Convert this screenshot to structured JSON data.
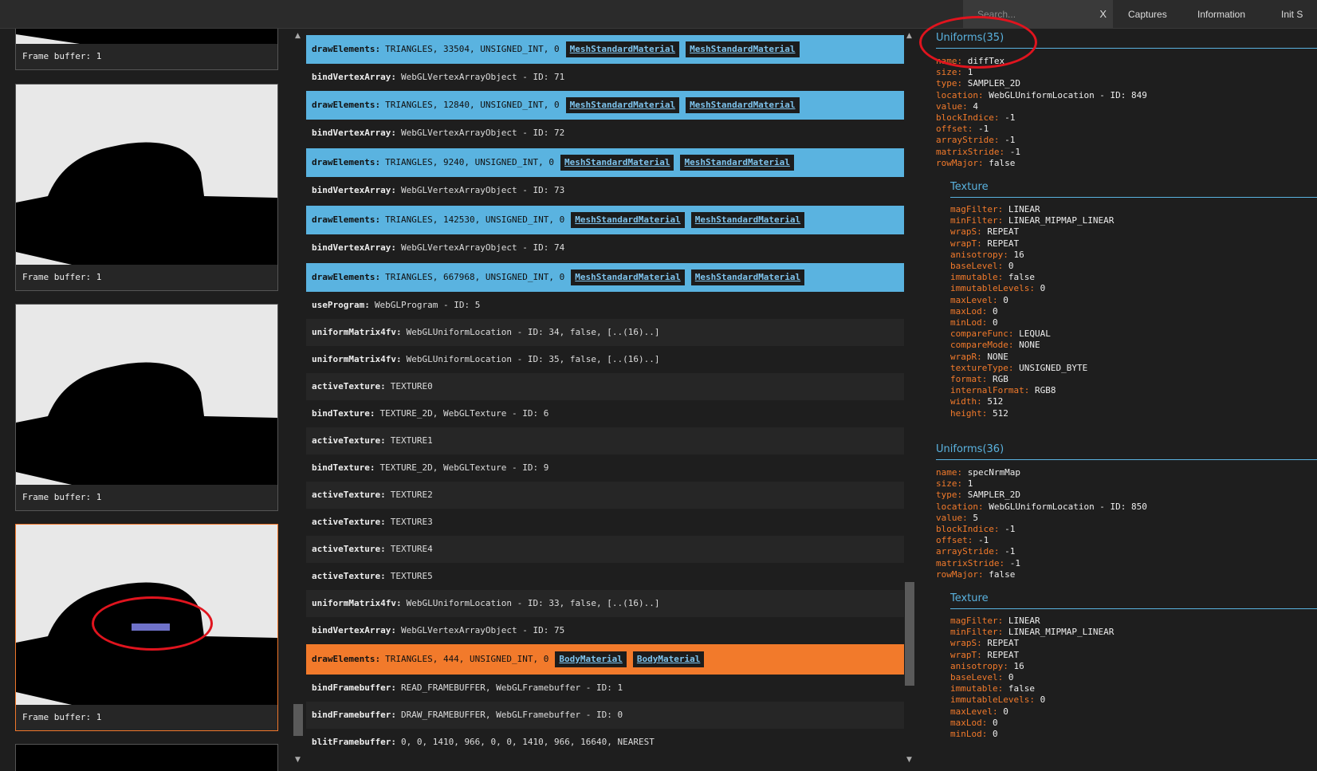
{
  "topbar": {
    "search_placeholder": "Search...",
    "search_close": "X",
    "tabs": [
      "Captures",
      "Information",
      "Init S"
    ]
  },
  "thumbnails": [
    {
      "caption": "Frame buffer: 1"
    },
    {
      "caption": "Frame buffer: 1"
    },
    {
      "caption": "Frame buffer: 1"
    },
    {
      "caption": "Frame buffer: 1",
      "selected": true
    }
  ],
  "commands": [
    {
      "fn": "drawElements:",
      "args": "TRIANGLES, 33504, UNSIGNED_INT, 0",
      "materials": [
        "MeshStandardMaterial",
        "MeshStandardMaterial"
      ],
      "style": "draw"
    },
    {
      "fn": "bindVertexArray:",
      "args": "WebGLVertexArrayObject - ID: 71",
      "style": "plain"
    },
    {
      "fn": "drawElements:",
      "args": "TRIANGLES, 12840, UNSIGNED_INT, 0",
      "materials": [
        "MeshStandardMaterial",
        "MeshStandardMaterial"
      ],
      "style": "draw"
    },
    {
      "fn": "bindVertexArray:",
      "args": "WebGLVertexArrayObject - ID: 72",
      "style": "plain"
    },
    {
      "fn": "drawElements:",
      "args": "TRIANGLES, 9240, UNSIGNED_INT, 0",
      "materials": [
        "MeshStandardMaterial",
        "MeshStandardMaterial"
      ],
      "style": "draw"
    },
    {
      "fn": "bindVertexArray:",
      "args": "WebGLVertexArrayObject - ID: 73",
      "style": "plain"
    },
    {
      "fn": "drawElements:",
      "args": "TRIANGLES, 142530, UNSIGNED_INT, 0",
      "materials": [
        "MeshStandardMaterial",
        "MeshStandardMaterial"
      ],
      "style": "draw"
    },
    {
      "fn": "bindVertexArray:",
      "args": "WebGLVertexArrayObject - ID: 74",
      "style": "plain"
    },
    {
      "fn": "drawElements:",
      "args": "TRIANGLES, 667968, UNSIGNED_INT, 0",
      "materials": [
        "MeshStandardMaterial",
        "MeshStandardMaterial"
      ],
      "style": "draw"
    },
    {
      "fn": "useProgram:",
      "args": "WebGLProgram - ID: 5",
      "style": "plain"
    },
    {
      "fn": "uniformMatrix4fv:",
      "args": "WebGLUniformLocation - ID: 34, false, [..(16)..]",
      "style": "alt"
    },
    {
      "fn": "uniformMatrix4fv:",
      "args": "WebGLUniformLocation - ID: 35, false, [..(16)..]",
      "style": "plain"
    },
    {
      "fn": "activeTexture:",
      "args": "TEXTURE0",
      "style": "alt"
    },
    {
      "fn": "bindTexture:",
      "args": "TEXTURE_2D, WebGLTexture - ID: 6",
      "style": "plain"
    },
    {
      "fn": "activeTexture:",
      "args": "TEXTURE1",
      "style": "alt"
    },
    {
      "fn": "bindTexture:",
      "args": "TEXTURE_2D, WebGLTexture - ID: 9",
      "style": "plain"
    },
    {
      "fn": "activeTexture:",
      "args": "TEXTURE2",
      "style": "alt"
    },
    {
      "fn": "activeTexture:",
      "args": "TEXTURE3",
      "style": "plain"
    },
    {
      "fn": "activeTexture:",
      "args": "TEXTURE4",
      "style": "alt"
    },
    {
      "fn": "activeTexture:",
      "args": "TEXTURE5",
      "style": "plain"
    },
    {
      "fn": "uniformMatrix4fv:",
      "args": "WebGLUniformLocation - ID: 33, false, [..(16)..]",
      "style": "alt"
    },
    {
      "fn": "bindVertexArray:",
      "args": "WebGLVertexArrayObject - ID: 75",
      "style": "plain"
    },
    {
      "fn": "drawElements:",
      "args": "TRIANGLES, 444, UNSIGNED_INT, 0",
      "materials": [
        "BodyMaterial",
        "BodyMaterial"
      ],
      "style": "draw-orange"
    },
    {
      "fn": "bindFramebuffer:",
      "args": "READ_FRAMEBUFFER, WebGLFramebuffer - ID: 1",
      "style": "plain"
    },
    {
      "fn": "bindFramebuffer:",
      "args": "DRAW_FRAMEBUFFER, WebGLFramebuffer - ID: 0",
      "style": "alt"
    },
    {
      "fn": "blitFramebuffer:",
      "args": "0, 0, 1410, 966, 0, 0, 1410, 966, 16640, NEAREST",
      "style": "plain"
    }
  ],
  "uniforms": [
    {
      "title": "Uniforms(35)",
      "fields": [
        [
          "name:",
          "diffTex"
        ],
        [
          "size:",
          "1"
        ],
        [
          "type:",
          "SAMPLER_2D"
        ],
        [
          "location:",
          "WebGLUniformLocation - ID: 849"
        ],
        [
          "value:",
          "4"
        ],
        [
          "blockIndice:",
          "-1"
        ],
        [
          "offset:",
          "-1"
        ],
        [
          "arrayStride:",
          "-1"
        ],
        [
          "matrixStride:",
          "-1"
        ],
        [
          "rowMajor:",
          "false"
        ]
      ],
      "texture_title": "Texture",
      "texture": [
        [
          "magFilter:",
          "LINEAR"
        ],
        [
          "minFilter:",
          "LINEAR_MIPMAP_LINEAR"
        ],
        [
          "wrapS:",
          "REPEAT"
        ],
        [
          "wrapT:",
          "REPEAT"
        ],
        [
          "anisotropy:",
          "16"
        ],
        [
          "baseLevel:",
          "0"
        ],
        [
          "immutable:",
          "false"
        ],
        [
          "immutableLevels:",
          "0"
        ],
        [
          "maxLevel:",
          "0"
        ],
        [
          "maxLod:",
          "0"
        ],
        [
          "minLod:",
          "0"
        ],
        [
          "compareFunc:",
          "LEQUAL"
        ],
        [
          "compareMode:",
          "NONE"
        ],
        [
          "wrapR:",
          "NONE"
        ],
        [
          "textureType:",
          "UNSIGNED_BYTE"
        ],
        [
          "format:",
          "RGB"
        ],
        [
          "internalFormat:",
          "RGB8"
        ],
        [
          "width:",
          "512"
        ],
        [
          "height:",
          "512"
        ]
      ]
    },
    {
      "title": "Uniforms(36)",
      "fields": [
        [
          "name:",
          "specNrmMap"
        ],
        [
          "size:",
          "1"
        ],
        [
          "type:",
          "SAMPLER_2D"
        ],
        [
          "location:",
          "WebGLUniformLocation - ID: 850"
        ],
        [
          "value:",
          "5"
        ],
        [
          "blockIndice:",
          "-1"
        ],
        [
          "offset:",
          "-1"
        ],
        [
          "arrayStride:",
          "-1"
        ],
        [
          "matrixStride:",
          "-1"
        ],
        [
          "rowMajor:",
          "false"
        ]
      ],
      "texture_title": "Texture",
      "texture": [
        [
          "magFilter:",
          "LINEAR"
        ],
        [
          "minFilter:",
          "LINEAR_MIPMAP_LINEAR"
        ],
        [
          "wrapS:",
          "REPEAT"
        ],
        [
          "wrapT:",
          "REPEAT"
        ],
        [
          "anisotropy:",
          "16"
        ],
        [
          "baseLevel:",
          "0"
        ],
        [
          "immutable:",
          "false"
        ],
        [
          "immutableLevels:",
          "0"
        ],
        [
          "maxLevel:",
          "0"
        ],
        [
          "maxLod:",
          "0"
        ],
        [
          "minLod:",
          "0"
        ]
      ]
    }
  ],
  "colors": {
    "accent_blue": "#5ab3e0",
    "accent_orange": "#f27a2b",
    "annotation_red": "#e0141e"
  }
}
